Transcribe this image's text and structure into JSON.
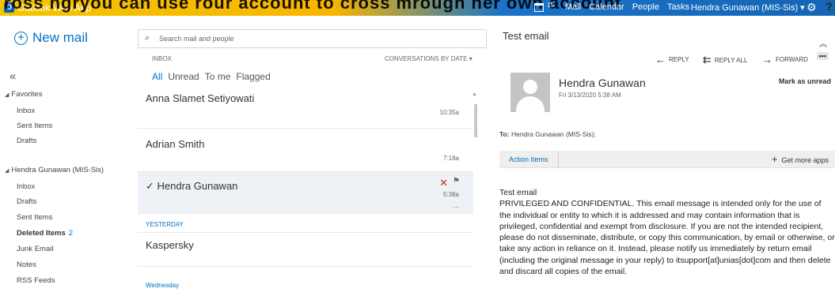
{
  "topbar": {
    "app_name": "Outlook Web App",
    "overlay_text": "ross ngryou can use rour account to cross mrough her own account",
    "calendar_badge": "15",
    "nav": [
      "Mail",
      "Calendar",
      "People",
      "Tasks"
    ],
    "user": "Hendra Gunawan (MIS-Sis) ▾",
    "icons": [
      "calendar-icon",
      "gear-icon",
      "help-icon"
    ]
  },
  "left": {
    "new_mail": "New mail",
    "collapse": "«",
    "favorites_label": "Favorites",
    "favorites": [
      "Inbox",
      "Sent Items",
      "Drafts"
    ],
    "account_label": "Hendra Gunawan (MIS-Sis)",
    "folders": [
      "Inbox",
      "Drafts",
      "Sent Items",
      "Deleted Items",
      "Junk Email",
      "Notes",
      "RSS Feeds"
    ],
    "deleted_count": "2"
  },
  "middle": {
    "search_placeholder": "Search mail and people",
    "inbox_label": "INBOX",
    "sort_label": "CONVERSATIONS BY DATE ▾",
    "filters": [
      "All",
      "Unread",
      "To me",
      "Flagged"
    ],
    "messages": [
      {
        "sender": "Anna Slamet Setiyowati",
        "time": "10:35a"
      },
      {
        "sender": "Adrian Smith",
        "time": "7:18a"
      },
      {
        "sender": "✓ Hendra Gunawan",
        "time": "5:38a",
        "dots": "..."
      },
      {
        "sender": "Kaspersky",
        "time": ""
      }
    ],
    "section_yesterday": "YESTERDAY",
    "section_wednesday": "Wednesday"
  },
  "reading": {
    "subject": "Test email",
    "reply": "REPLY",
    "reply_all": "REPLY ALL",
    "forward": "FORWARD",
    "more": "•••",
    "from_name": "Hendra Gunawan",
    "from_date": "Fri 3/13/2020 5:38 AM",
    "mark_unread": "Mark as unread",
    "to_label": "To:",
    "to_value": "Hendra Gunawan (MIS-Sis);",
    "addin_tab": "Action Items",
    "get_apps": "Get more apps",
    "body_title": "Test email",
    "body": "PRIVILEGED AND CONFIDENTIAL. This email message is intended only for the use of the individual or entity to which it is addressed and may contain information that is privileged, confidential and exempt from disclosure. If you are not the intended recipient, please do not disseminate, distribute, or copy this communication, by email or otherwise, or take any action in reliance on it. Instead, please notify us immediately by return email (including the original message in your reply) to itsupport[at]unias[dot]com and then delete and discard all copies of the email."
  }
}
